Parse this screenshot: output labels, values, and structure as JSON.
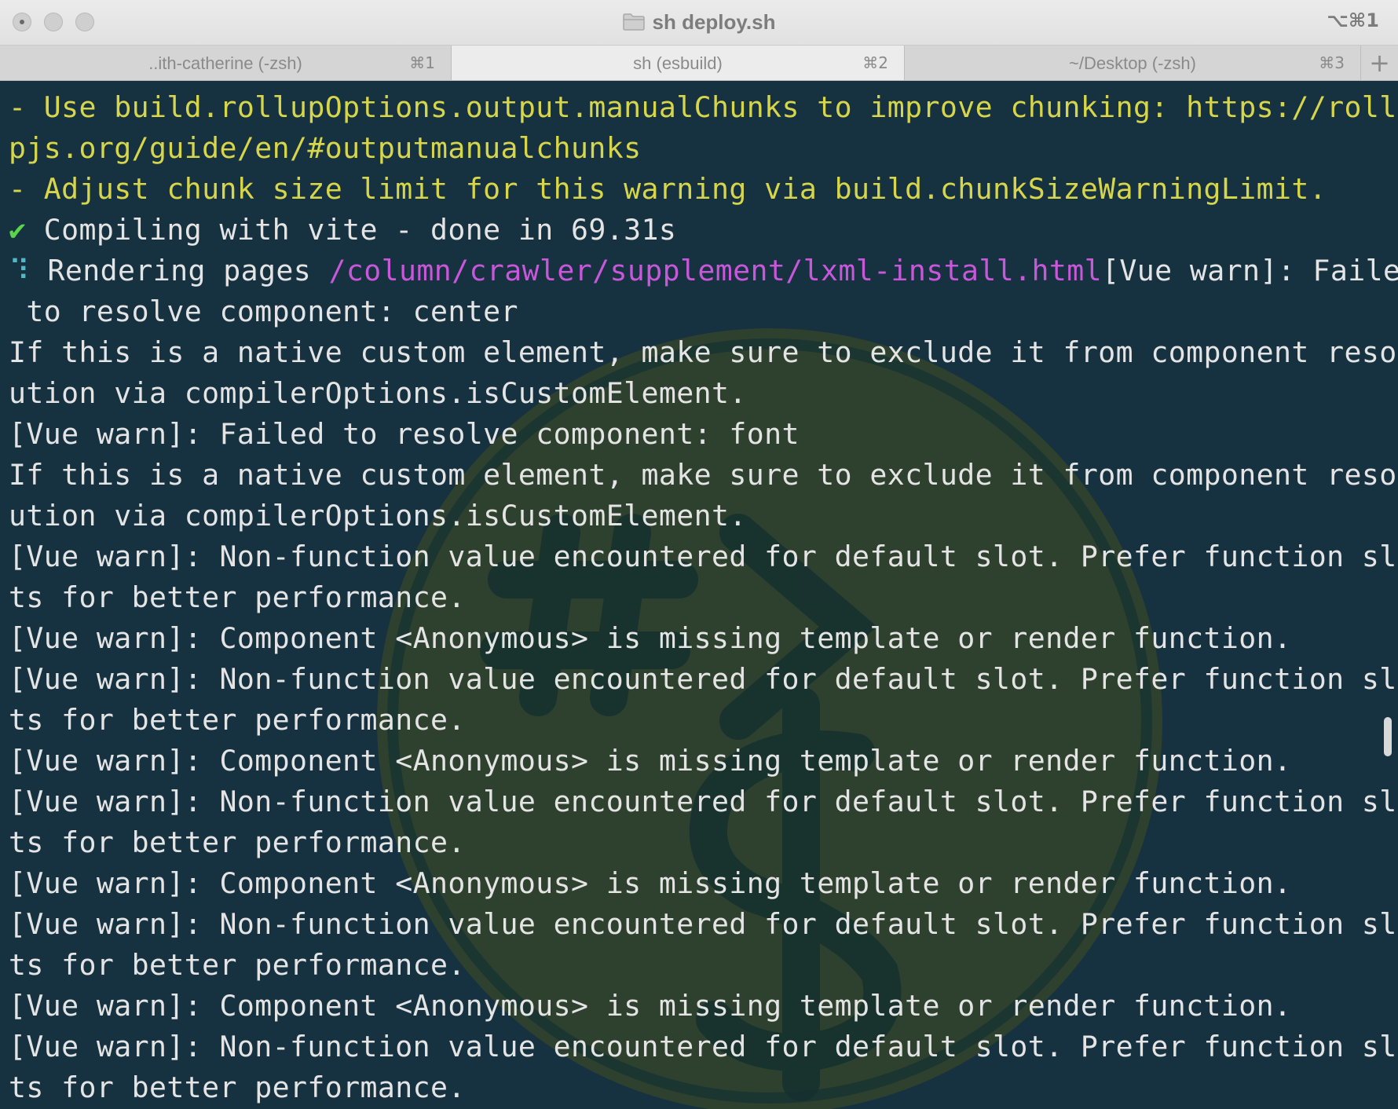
{
  "window": {
    "title": "sh deploy.sh",
    "shortcut": "⌥⌘1"
  },
  "tabs": [
    {
      "label": "..ith-catherine (-zsh)",
      "shortcut": "⌘1"
    },
    {
      "label": "sh (esbuild)",
      "shortcut": "⌘2"
    },
    {
      "label": "~/Desktop (-zsh)",
      "shortcut": "⌘3"
    }
  ],
  "add_tab_label": "+",
  "terminal": {
    "lines": [
      {
        "text": "- Use build.rollupOptions.output.manualChunks to improve chunking: https://rollu"
      },
      {
        "text": "pjs.org/guide/en/#outputmanualchunks"
      },
      {
        "text": "- Adjust chunk size limit for this warning via build.chunkSizeWarningLimit."
      },
      {
        "check": "✔",
        "text": " Compiling with vite - done in 69.31s"
      },
      {
        "spinner": "⠹",
        "prefix": " Rendering pages ",
        "path": "/column/crawler/supplement/lxml-install.html",
        "text": "[Vue warn]: Failed"
      },
      {
        "text": " to resolve component: center"
      },
      {
        "text": "If this is a native custom element, make sure to exclude it from component resol"
      },
      {
        "text": "ution via compilerOptions.isCustomElement."
      },
      {
        "text": "[Vue warn]: Failed to resolve component: font"
      },
      {
        "text": "If this is a native custom element, make sure to exclude it from component resol"
      },
      {
        "text": "ution via compilerOptions.isCustomElement."
      },
      {
        "text": "[Vue warn]: Non-function value encountered for default slot. Prefer function slo"
      },
      {
        "text": "ts for better performance."
      },
      {
        "text": "[Vue warn]: Component <Anonymous> is missing template or render function."
      },
      {
        "text": "[Vue warn]: Non-function value encountered for default slot. Prefer function slo"
      },
      {
        "text": "ts for better performance."
      },
      {
        "text": "[Vue warn]: Component <Anonymous> is missing template or render function."
      },
      {
        "text": "[Vue warn]: Non-function value encountered for default slot. Prefer function slo"
      },
      {
        "text": "ts for better performance."
      },
      {
        "text": "[Vue warn]: Component <Anonymous> is missing template or render function."
      },
      {
        "text": "[Vue warn]: Non-function value encountered for default slot. Prefer function slo"
      },
      {
        "text": "ts for better performance."
      },
      {
        "text": "[Vue warn]: Component <Anonymous> is missing template or render function."
      },
      {
        "text": "[Vue warn]: Non-function value encountered for default slot. Prefer function slo"
      },
      {
        "text": "ts for better performance."
      }
    ]
  },
  "colors": {
    "background": "#163140",
    "text": "#e4e4e4",
    "yellow": "#d7d64a",
    "magenta": "#c857d9",
    "green": "#5bd34c"
  },
  "icons": {
    "title": "folder-icon",
    "watermark": "terminal-logo-watermark"
  }
}
